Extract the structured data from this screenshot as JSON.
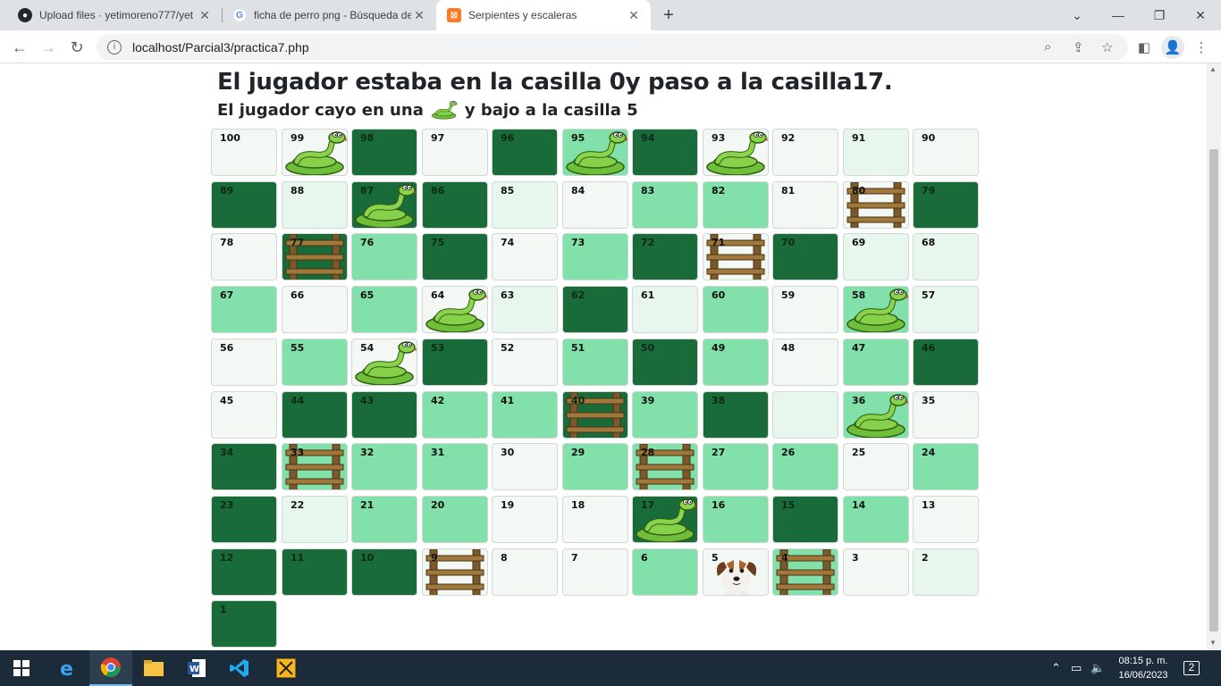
{
  "browser": {
    "tabs": [
      {
        "title": "Upload files · yetimoreno777/yet",
        "icon": "github-icon",
        "active": false
      },
      {
        "title": "ficha de perro png - Búsqueda de",
        "icon": "google-icon",
        "active": false
      },
      {
        "title": "Serpientes y escaleras",
        "icon": "xampp-icon",
        "active": true
      }
    ],
    "url": "localhost/Parcial3/practica7.php"
  },
  "page": {
    "heading": "El jugador estaba en la casilla 0y paso a la casilla17.",
    "subheading_before": "El jugador cayo en una",
    "subheading_after": "y bajo a la casilla 5"
  },
  "board": {
    "rows": [
      [
        {
          "n": "100",
          "c": "light",
          "i": ""
        },
        {
          "n": "99",
          "c": "light",
          "i": "snake"
        },
        {
          "n": "98",
          "c": "dark",
          "i": ""
        },
        {
          "n": "97",
          "c": "light",
          "i": ""
        },
        {
          "n": "96",
          "c": "dark",
          "i": ""
        },
        {
          "n": "95",
          "c": "green",
          "i": "snake"
        },
        {
          "n": "94",
          "c": "dark",
          "i": ""
        },
        {
          "n": "93",
          "c": "light",
          "i": "snake"
        },
        {
          "n": "92",
          "c": "light",
          "i": ""
        },
        {
          "n": "91",
          "c": "mint",
          "i": ""
        },
        {
          "n": "90",
          "c": "light",
          "i": ""
        }
      ],
      [
        {
          "n": "89",
          "c": "dark",
          "i": ""
        },
        {
          "n": "88",
          "c": "mint",
          "i": ""
        },
        {
          "n": "87",
          "c": "dark",
          "i": "snake"
        },
        {
          "n": "86",
          "c": "dark",
          "i": ""
        },
        {
          "n": "85",
          "c": "mint",
          "i": ""
        },
        {
          "n": "84",
          "c": "light",
          "i": ""
        },
        {
          "n": "83",
          "c": "green",
          "i": ""
        },
        {
          "n": "82",
          "c": "green",
          "i": ""
        },
        {
          "n": "81",
          "c": "light",
          "i": ""
        },
        {
          "n": "80",
          "c": "light",
          "i": "ladder"
        },
        {
          "n": "79",
          "c": "dark",
          "i": ""
        }
      ],
      [
        {
          "n": "78",
          "c": "light",
          "i": ""
        },
        {
          "n": "77",
          "c": "dark",
          "i": "ladder"
        },
        {
          "n": "76",
          "c": "green",
          "i": ""
        },
        {
          "n": "75",
          "c": "dark",
          "i": ""
        },
        {
          "n": "74",
          "c": "light",
          "i": ""
        },
        {
          "n": "73",
          "c": "green",
          "i": ""
        },
        {
          "n": "72",
          "c": "dark",
          "i": ""
        },
        {
          "n": "71",
          "c": "light",
          "i": "ladder"
        },
        {
          "n": "70",
          "c": "dark",
          "i": ""
        },
        {
          "n": "69",
          "c": "mint",
          "i": ""
        },
        {
          "n": "68",
          "c": "mint",
          "i": ""
        }
      ],
      [
        {
          "n": "67",
          "c": "green",
          "i": ""
        },
        {
          "n": "66",
          "c": "light",
          "i": ""
        },
        {
          "n": "65",
          "c": "green",
          "i": ""
        },
        {
          "n": "64",
          "c": "light",
          "i": "snake"
        },
        {
          "n": "63",
          "c": "mint",
          "i": ""
        },
        {
          "n": "62",
          "c": "dark",
          "i": ""
        },
        {
          "n": "61",
          "c": "mint",
          "i": ""
        },
        {
          "n": "60",
          "c": "green",
          "i": ""
        },
        {
          "n": "59",
          "c": "light",
          "i": ""
        },
        {
          "n": "58",
          "c": "green",
          "i": "snake"
        },
        {
          "n": "57",
          "c": "mint",
          "i": ""
        }
      ],
      [
        {
          "n": "56",
          "c": "light",
          "i": ""
        },
        {
          "n": "55",
          "c": "green",
          "i": ""
        },
        {
          "n": "54",
          "c": "light",
          "i": "snake"
        },
        {
          "n": "53",
          "c": "dark",
          "i": ""
        },
        {
          "n": "52",
          "c": "light",
          "i": ""
        },
        {
          "n": "51",
          "c": "green",
          "i": ""
        },
        {
          "n": "50",
          "c": "dark",
          "i": ""
        },
        {
          "n": "49",
          "c": "green",
          "i": ""
        },
        {
          "n": "48",
          "c": "light",
          "i": ""
        },
        {
          "n": "47",
          "c": "green",
          "i": ""
        },
        {
          "n": "46",
          "c": "dark",
          "i": ""
        }
      ],
      [
        {
          "n": "45",
          "c": "light",
          "i": ""
        },
        {
          "n": "44",
          "c": "dark",
          "i": ""
        },
        {
          "n": "43",
          "c": "dark",
          "i": ""
        },
        {
          "n": "42",
          "c": "green",
          "i": ""
        },
        {
          "n": "41",
          "c": "green",
          "i": ""
        },
        {
          "n": "40",
          "c": "dark",
          "i": "ladder"
        },
        {
          "n": "39",
          "c": "green",
          "i": ""
        },
        {
          "n": "38",
          "c": "dark",
          "i": ""
        },
        {
          "n": "",
          "c": "mint",
          "i": ""
        },
        {
          "n": "36",
          "c": "green",
          "i": "snake"
        },
        {
          "n": "35",
          "c": "light",
          "i": ""
        }
      ],
      [
        {
          "n": "34",
          "c": "dark",
          "i": ""
        },
        {
          "n": "33",
          "c": "green",
          "i": "ladder"
        },
        {
          "n": "32",
          "c": "green",
          "i": ""
        },
        {
          "n": "31",
          "c": "green",
          "i": ""
        },
        {
          "n": "30",
          "c": "light",
          "i": ""
        },
        {
          "n": "29",
          "c": "green",
          "i": ""
        },
        {
          "n": "28",
          "c": "green",
          "i": "ladder"
        },
        {
          "n": "27",
          "c": "green",
          "i": ""
        },
        {
          "n": "26",
          "c": "green",
          "i": ""
        },
        {
          "n": "25",
          "c": "light",
          "i": ""
        },
        {
          "n": "24",
          "c": "green",
          "i": ""
        }
      ],
      [
        {
          "n": "23",
          "c": "dark",
          "i": ""
        },
        {
          "n": "22",
          "c": "mint",
          "i": ""
        },
        {
          "n": "21",
          "c": "green",
          "i": ""
        },
        {
          "n": "20",
          "c": "green",
          "i": ""
        },
        {
          "n": "19",
          "c": "light",
          "i": ""
        },
        {
          "n": "18",
          "c": "light",
          "i": ""
        },
        {
          "n": "17",
          "c": "dark",
          "i": "snake"
        },
        {
          "n": "16",
          "c": "green",
          "i": ""
        },
        {
          "n": "15",
          "c": "dark",
          "i": ""
        },
        {
          "n": "14",
          "c": "green",
          "i": ""
        },
        {
          "n": "13",
          "c": "light",
          "i": ""
        }
      ],
      [
        {
          "n": "12",
          "c": "dark",
          "i": ""
        },
        {
          "n": "11",
          "c": "dark",
          "i": ""
        },
        {
          "n": "10",
          "c": "dark",
          "i": ""
        },
        {
          "n": "9",
          "c": "light",
          "i": "ladder"
        },
        {
          "n": "8",
          "c": "light",
          "i": ""
        },
        {
          "n": "7",
          "c": "light",
          "i": ""
        },
        {
          "n": "6",
          "c": "green",
          "i": ""
        },
        {
          "n": "5",
          "c": "light",
          "i": "dog"
        },
        {
          "n": "4",
          "c": "green",
          "i": "ladder"
        },
        {
          "n": "3",
          "c": "light",
          "i": ""
        },
        {
          "n": "2",
          "c": "mint",
          "i": ""
        }
      ],
      [
        {
          "n": "1",
          "c": "dark",
          "i": ""
        }
      ]
    ]
  },
  "taskbar": {
    "time": "08:15 p. m.",
    "date": "16/06/2023",
    "notifications": "2"
  }
}
